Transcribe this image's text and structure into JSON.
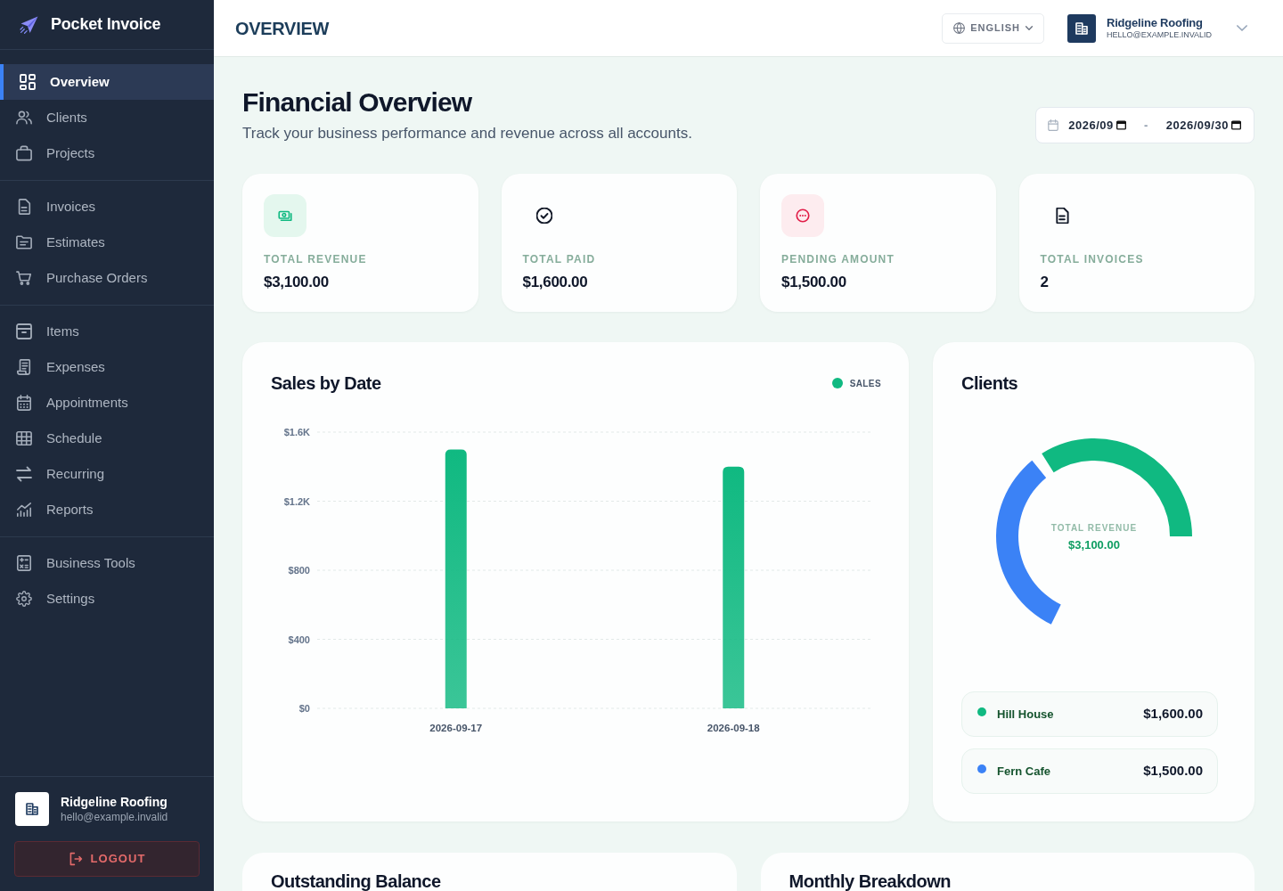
{
  "sidebar": {
    "brand": "Pocket Invoice",
    "groups": [
      {
        "items": [
          {
            "label": "Overview",
            "selected": true
          },
          {
            "label": "Clients",
            "selected": false
          },
          {
            "label": "Projects",
            "selected": false
          }
        ]
      },
      {
        "items": [
          {
            "label": "Invoices",
            "selected": false
          },
          {
            "label": "Estimates",
            "selected": false
          },
          {
            "label": "Purchase Orders",
            "selected": false
          }
        ]
      },
      {
        "items": [
          {
            "label": "Items",
            "selected": false
          },
          {
            "label": "Expenses",
            "selected": false
          },
          {
            "label": "Appointments",
            "selected": false
          },
          {
            "label": "Schedule",
            "selected": false
          },
          {
            "label": "Recurring",
            "selected": false
          },
          {
            "label": "Reports",
            "selected": false
          }
        ]
      },
      {
        "items": [
          {
            "label": "Business Tools",
            "selected": false
          },
          {
            "label": "Settings",
            "selected": false
          }
        ]
      }
    ],
    "account": {
      "name": "Ridgeline Roofing",
      "email": "hello@example.invalid"
    },
    "logout": "LOGOUT"
  },
  "header": {
    "title": "OVERVIEW",
    "language": "ENGLISH",
    "account": {
      "name": "Ridgeline Roofing",
      "email": "HELLO@EXAMPLE.INVALID"
    }
  },
  "page": {
    "title": "Financial Overview",
    "subtitle": "Track your business performance and revenue across all accounts.",
    "date_range": {
      "start": "2026/09",
      "separator": "-",
      "end": "2026/09/30"
    }
  },
  "stats": [
    {
      "kind": "revenue",
      "label": "TOTAL REVENUE",
      "value": "$3,100.00"
    },
    {
      "kind": "paid",
      "label": "TOTAL PAID",
      "value": "$1,600.00"
    },
    {
      "kind": "pending",
      "label": "PENDING AMOUNT",
      "value": "$1,500.00"
    },
    {
      "kind": "count",
      "label": "TOTAL INVOICES",
      "value": "2"
    }
  ],
  "sales_card": {
    "chart_data": {
      "type": "bar",
      "title": "Sales by Date",
      "categories": [
        "2026-09-17",
        "2026-09-18"
      ],
      "series": [
        {
          "name": "SALES",
          "color": "#10b981",
          "values": [
            1500,
            1400
          ]
        }
      ],
      "ylim": [
        0,
        1600
      ],
      "yticks": [
        {
          "value": 0,
          "label": "$0"
        },
        {
          "value": 400,
          "label": "$400"
        },
        {
          "value": 800,
          "label": "$800"
        },
        {
          "value": 1200,
          "label": "$1.2K"
        },
        {
          "value": 1600,
          "label": "$1.6K"
        }
      ],
      "grid": true
    }
  },
  "clients_card": {
    "chart_data": {
      "type": "donut",
      "title": "Clients",
      "categories": [
        "Hill House",
        "Fern Cafe"
      ],
      "values": [
        51.6,
        48.4
      ]
    },
    "center_label": "TOTAL REVENUE",
    "center_value": "$3,100.00",
    "legend": [
      {
        "amount": "$1,600.00",
        "color": "#10b981"
      },
      {
        "amount": "$1,500.00",
        "color": "#3b82f6"
      }
    ]
  },
  "bottom_cards": [
    {
      "title": "Outstanding Balance"
    },
    {
      "title": "Monthly Breakdown"
    }
  ]
}
